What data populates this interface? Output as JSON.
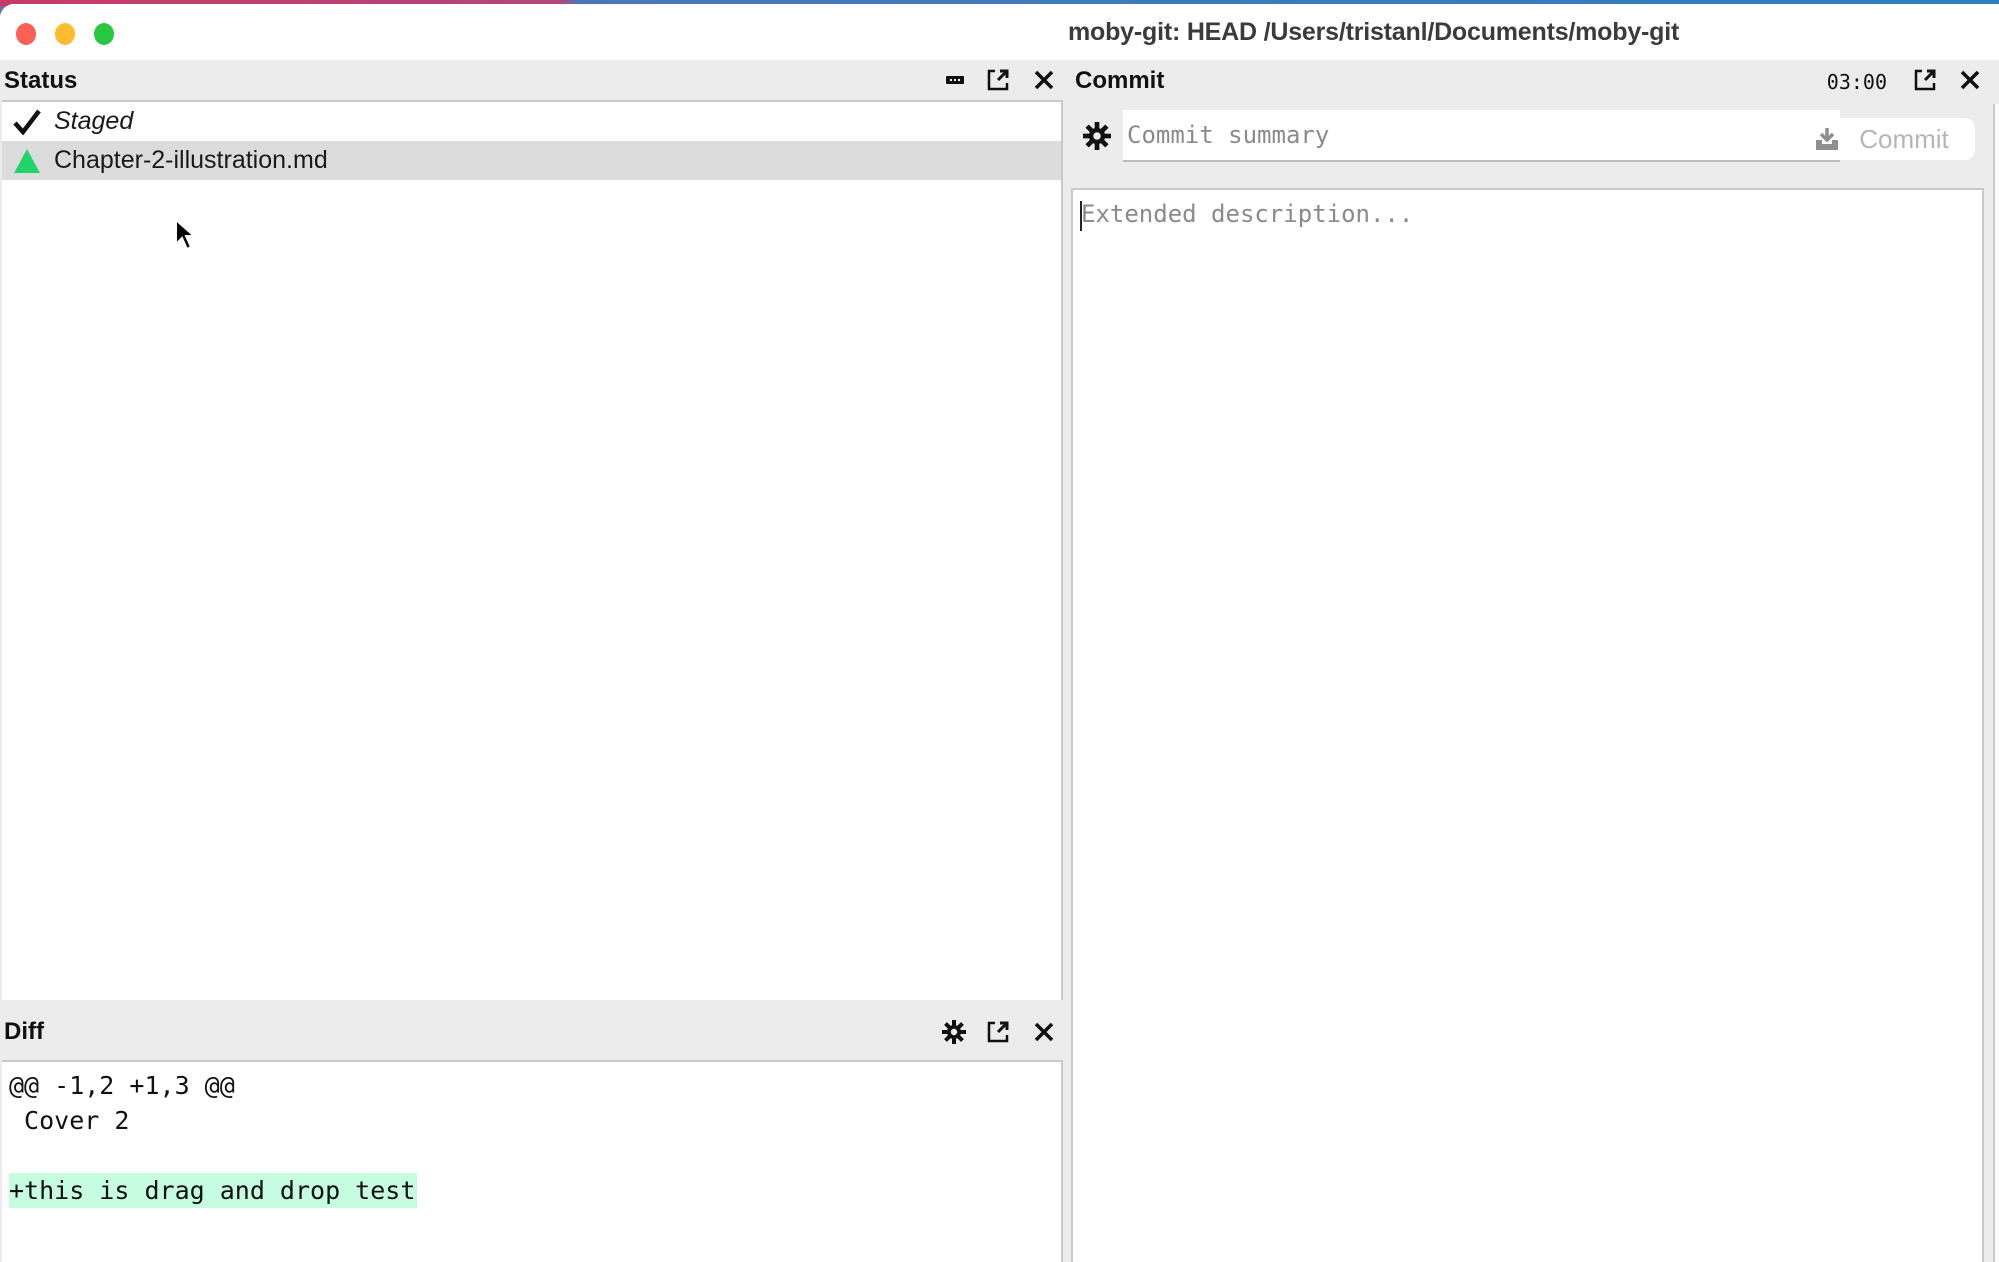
{
  "window": {
    "title": "moby-git: HEAD /Users/tristanl/Documents/moby-git",
    "controls": [
      "close",
      "minimize",
      "zoom"
    ]
  },
  "status_panel": {
    "title": "Status",
    "header_icons": [
      "minimize-icon",
      "popout-icon",
      "close-icon"
    ],
    "tree": [
      {
        "label": "Staged",
        "icon": "checkmark-icon",
        "italic": true,
        "selected": false
      },
      {
        "label": "Chapter-2-illustration.md",
        "icon": "added-triangle-icon",
        "selected": true
      }
    ]
  },
  "diff_panel": {
    "title": "Diff",
    "header_icons": [
      "gear-icon",
      "popout-icon",
      "close-icon"
    ],
    "lines": [
      {
        "text": "@@ -1,2 +1,3 @@",
        "type": "hunk"
      },
      {
        "text": " Cover 2",
        "type": "context"
      },
      {
        "text": "",
        "type": "context"
      },
      {
        "text": "+this is drag and drop test",
        "type": "added"
      }
    ]
  },
  "commit_panel": {
    "title": "Commit",
    "timer": "03:00",
    "header_icons": [
      "popout-icon",
      "close-icon"
    ],
    "summary_placeholder": "Commit summary",
    "summary_value": "",
    "commit_button_label": "Commit",
    "commit_button_enabled": false,
    "description_placeholder": "Extended description...",
    "description_value": ""
  },
  "colors": {
    "added_icon": "#22d36a",
    "added_line_bg": "#c6fce0",
    "selected_row_bg": "#dcdcdc",
    "panel_header_bg": "#ececec"
  }
}
